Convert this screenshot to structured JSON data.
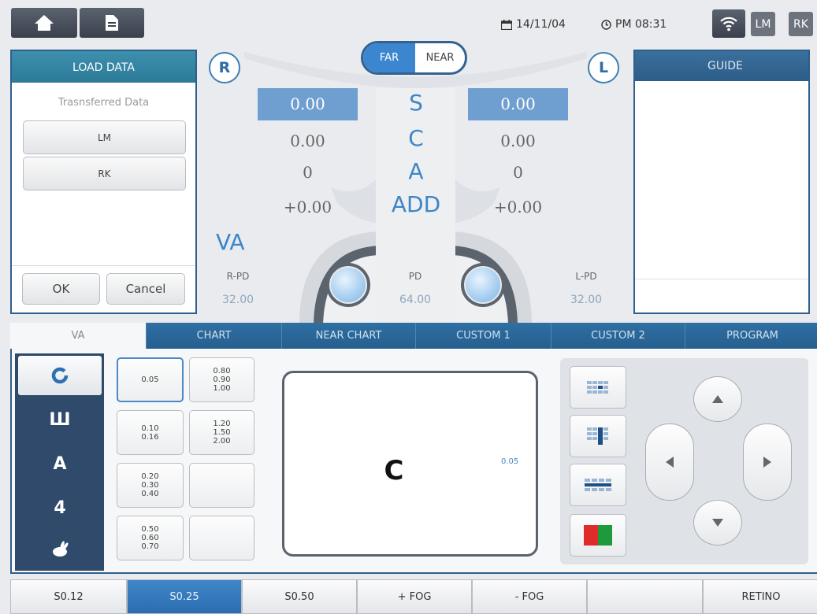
{
  "status": {
    "date": "14/11/04",
    "time": "PM 08:31",
    "badges": [
      "LM",
      "RK"
    ]
  },
  "load_data": {
    "title": "LOAD DATA",
    "subtitle": "Trasnsferred Data",
    "items": [
      "LM",
      "RK"
    ],
    "ok": "OK",
    "cancel": "Cancel"
  },
  "mode": {
    "far": "FAR",
    "near": "NEAR",
    "selected": "FAR"
  },
  "right_eye": {
    "label": "R",
    "S": "0.00",
    "C": "0.00",
    "A": "0",
    "ADD": "+0.00"
  },
  "left_eye": {
    "label": "L",
    "S": "0.00",
    "C": "0.00",
    "A": "0",
    "ADD": "+0.00"
  },
  "rows": [
    "S",
    "C",
    "A",
    "ADD"
  ],
  "va_label": "VA",
  "pd": {
    "r_label": "R-PD",
    "r_value": "32.00",
    "label": "PD",
    "value": "64.00",
    "l_label": "L-PD",
    "l_value": "32.00"
  },
  "guide": {
    "title": "GUIDE"
  },
  "tabs": [
    "VA",
    "CHART",
    "NEAR CHART",
    "CUSTOM 1",
    "CUSTOM 2",
    "PROGRAM"
  ],
  "active_tab": "VA",
  "optotype_types": [
    "ring-c",
    "tumbling-e",
    "letter-a",
    "number-4",
    "rabbit"
  ],
  "optotype_glyphs": {
    "ring-c": "O",
    "tumbling-e": "Ш",
    "letter-a": "A",
    "number-4": "4"
  },
  "acuity_cells": [
    [
      "0.05",
      "0.80\n0.90\n1.00"
    ],
    [
      "0.10\n0.16",
      "1.20\n1.50\n2.00"
    ],
    [
      "0.20\n0.30\n0.40",
      ""
    ],
    [
      "0.50\n0.60\n0.70",
      ""
    ]
  ],
  "display": {
    "optotype": "C",
    "acuity": "0.05"
  },
  "toolbar": [
    "S0.12",
    "S0.25",
    "S0.50",
    "+ FOG",
    "- FOG",
    "",
    "RETINO"
  ],
  "toolbar_active": "S0.25",
  "colors": {
    "accent_blue": "#3d86c9",
    "highlight": "#6f9ed0",
    "dark_panel": "#2f4a6a",
    "red": "#e02b2b",
    "green": "#1f9a3a"
  }
}
